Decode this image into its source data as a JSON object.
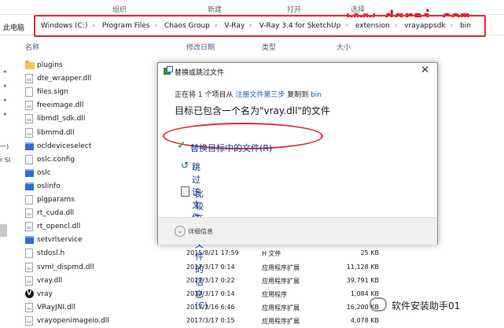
{
  "ribbon": {
    "organize": "组织",
    "new": "新建",
    "open": "打开",
    "select": "选择"
  },
  "watermark": "www.dgrai.com",
  "address": {
    "left_label": "此电脑",
    "crumbs": [
      "Windows (C:)",
      "Program Files",
      "Chaos Group",
      "V-Ray",
      "V-Ray 3.4 for SketchUp",
      "extension",
      "vrayappsdk",
      "bin"
    ]
  },
  "columns": {
    "name": "名称",
    "date": "修改日期",
    "type": "类型",
    "size": "大小"
  },
  "sidebar": {
    "frag1": "一)",
    "frag2": "r SI"
  },
  "files": [
    {
      "icon": "folder",
      "name": "plugins",
      "date": "",
      "type": "",
      "size": ""
    },
    {
      "icon": "dll",
      "name": "dte_wrapper.dll",
      "date": "",
      "type": "",
      "size": ""
    },
    {
      "icon": "file",
      "name": "files.sign",
      "date": "",
      "type": "",
      "size": ""
    },
    {
      "icon": "dll",
      "name": "freeimage.dll",
      "date": "",
      "type": "",
      "size": ""
    },
    {
      "icon": "dll",
      "name": "libmdl_sdk.dll",
      "date": "",
      "type": "",
      "size": ""
    },
    {
      "icon": "dll",
      "name": "libmmd.dll",
      "date": "",
      "type": "",
      "size": ""
    },
    {
      "icon": "exe",
      "name": "ocldeviceselect",
      "date": "",
      "type": "",
      "size": ""
    },
    {
      "icon": "file",
      "name": "oslc.config",
      "date": "",
      "type": "",
      "size": ""
    },
    {
      "icon": "exe",
      "name": "oslc",
      "date": "",
      "type": "",
      "size": ""
    },
    {
      "icon": "exe",
      "name": "oslinfo",
      "date": "",
      "type": "",
      "size": ""
    },
    {
      "icon": "file",
      "name": "plgparams",
      "date": "",
      "type": "",
      "size": ""
    },
    {
      "icon": "dll",
      "name": "rt_cuda.dll",
      "date": "",
      "type": "",
      "size": ""
    },
    {
      "icon": "dll",
      "name": "rt_opencl.dll",
      "date": "",
      "type": "",
      "size": ""
    },
    {
      "icon": "exe",
      "name": "setvrlservice",
      "date": "2017/3/16 23:5...",
      "type": "",
      "size": ""
    },
    {
      "icon": "file",
      "name": "stdosl.h",
      "date": "2015/8/21 17:59",
      "type": "H 文件",
      "size": "25 KB"
    },
    {
      "icon": "dll",
      "name": "svml_dispmd.dll",
      "date": "2017/3/17 0:14",
      "type": "应用程序扩展",
      "size": "11,128 KB"
    },
    {
      "icon": "dll",
      "name": "vray.dll",
      "date": "2017/3/17 0:22",
      "type": "应用程序扩展",
      "size": "39,791 KB"
    },
    {
      "icon": "vray",
      "name": "vray",
      "date": "2017/3/17 0:14",
      "type": "应用程序",
      "size": "1,084 KB"
    },
    {
      "icon": "dll",
      "name": "VRayJNI.dll",
      "date": "2017/3/16 6:46",
      "type": "应用程序扩展",
      "size": "16,200 KB"
    },
    {
      "icon": "dll",
      "name": "vrayopenimageio.dll",
      "date": "2017/3/17 0:15",
      "type": "应用程序扩展",
      "size": "4,078 KB"
    }
  ],
  "dialog": {
    "title": "替换或跳过文件",
    "close": "✕",
    "line1_prefix": "正在将 1 个项目从 ",
    "line1_src": "注册文件第三步",
    "line1_mid": " 复制到 ",
    "line1_dst": "bin",
    "headline": "目标已包含一个名为\"vray.dll\"的文件",
    "option_replace": "替换目标中的文件(R)",
    "option_skip": "跳过该文件(S)",
    "option_compare": "比较两个文件的信息(C)",
    "details": "详细信息"
  },
  "wechat_label": "软件安装助手01"
}
